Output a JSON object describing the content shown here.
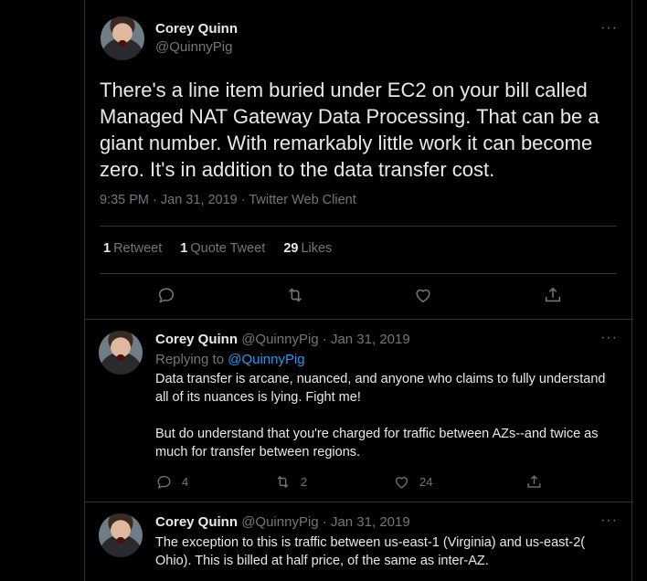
{
  "main_tweet": {
    "name": "Corey Quinn",
    "handle": "@QuinnyPig",
    "more": "···",
    "text": "There's a line item buried under EC2 on your bill called Managed NAT Gateway Data Processing. That can be a giant number. With remarkably little work it can become zero. It's in addition to the data transfer cost.",
    "meta": "9:35 PM · Jan 31, 2019 · Twitter Web Client",
    "retweets_count": "1",
    "retweets_label": "Retweet",
    "quotes_count": "1",
    "quotes_label": "Quote Tweet",
    "likes_count": "29",
    "likes_label": "Likes"
  },
  "replies": [
    {
      "name": "Corey Quinn",
      "handle": "@QuinnyPig · Jan 31, 2019",
      "more": "···",
      "replying_prefix": "Replying to",
      "replying_to": "@QuinnyPig",
      "paragraph1": "Data transfer is arcane, nuanced, and anyone who claims to fully understand all of its nuances is lying. Fight me!",
      "paragraph2": "But do understand that you're charged for traffic between AZs--and twice as much for transfer between regions.",
      "reply_count": "4",
      "retweet_count": "2",
      "like_count": "24"
    },
    {
      "name": "Corey Quinn",
      "handle": "@QuinnyPig · Jan 31, 2019",
      "more": "···",
      "text": "The exception to this is traffic between us-east-1 (Virginia) and us-east-2( Ohio). This is billed at half price, of the same as inter-AZ."
    }
  ],
  "icons": {
    "reply": "reply-icon",
    "retweet": "retweet-icon",
    "like": "heart-icon",
    "share": "share-icon"
  },
  "colors": {
    "background": "#000000",
    "text": "#e7e9ea",
    "muted": "#71767b",
    "link": "#1d9bf0",
    "border": "#2f3336"
  }
}
